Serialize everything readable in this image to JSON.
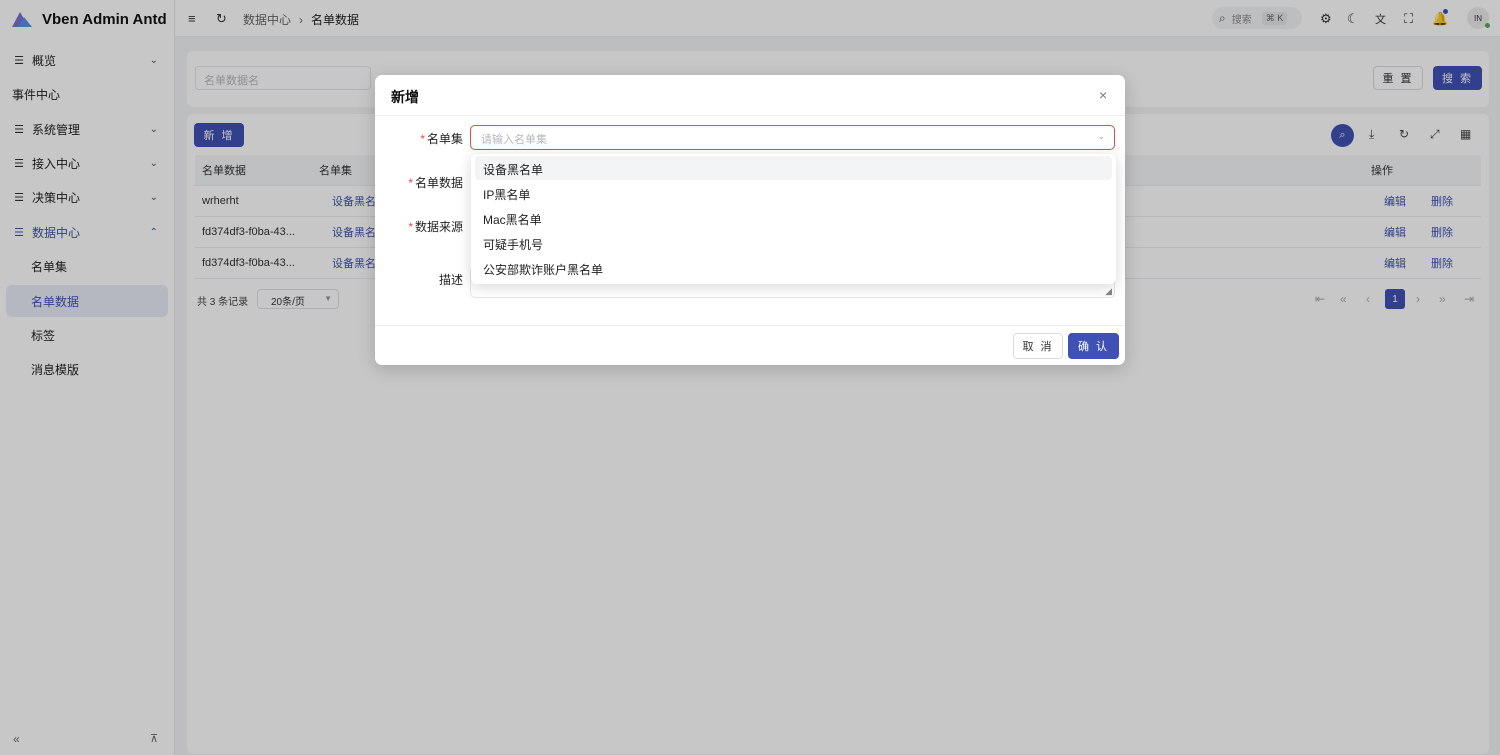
{
  "app": {
    "title": "Vben Admin Antd"
  },
  "sidebar": {
    "items": [
      {
        "label": "概览",
        "icon": "menu-lines-icon",
        "expandable": true
      },
      {
        "label": "事件中心"
      },
      {
        "label": "系统管理",
        "icon": "menu-lines-icon",
        "expandable": true
      },
      {
        "label": "接入中心",
        "icon": "menu-lines-icon",
        "expandable": true
      },
      {
        "label": "决策中心",
        "icon": "menu-lines-icon",
        "expandable": true
      },
      {
        "label": "数据中心",
        "icon": "menu-lines-icon",
        "expanded": true
      },
      {
        "label": "名单集"
      },
      {
        "label": "名单数据",
        "active": true
      },
      {
        "label": "标签"
      },
      {
        "label": "消息模版"
      }
    ]
  },
  "header": {
    "breadcrumb": [
      "数据中心",
      "名单数据"
    ],
    "search_label": "搜索",
    "search_shortcut": "⌘ K",
    "avatar_text": "IN"
  },
  "filter": {
    "name_placeholder": "名单数据名",
    "reset_label": "重 置",
    "search_label": "搜 索"
  },
  "toolbar": {
    "add_label": "新 增"
  },
  "table": {
    "columns": [
      "名单数据",
      "名单集",
      "操作"
    ],
    "rows": [
      {
        "data": "wrherht",
        "set": "设备黑名",
        "edit": "编辑",
        "delete": "删除"
      },
      {
        "data": "fd374df3-f0ba-43...",
        "set": "设备黑名",
        "edit": "编辑",
        "delete": "删除"
      },
      {
        "data": "fd374df3-f0ba-43...",
        "set": "设备黑名",
        "edit": "编辑",
        "delete": "删除"
      }
    ]
  },
  "pagination": {
    "total_text": "共 3 条记录",
    "page_size": "20条/页",
    "current_page": "1"
  },
  "modal": {
    "title": "新增",
    "fields": {
      "list_set_label": "名单集",
      "list_set_placeholder": "请输入名单集",
      "list_data_label": "名单数据",
      "data_source_label": "数据来源",
      "description_label": "描述"
    },
    "cancel_label": "取 消",
    "ok_label": "确 认"
  },
  "dropdown": {
    "options": [
      "设备黑名单",
      "IP黑名单",
      "Mac黑名单",
      "可疑手机号",
      "公安部欺诈账户黑名单"
    ]
  },
  "colors": {
    "primary": "#3f51b5",
    "error": "#e5484d"
  }
}
